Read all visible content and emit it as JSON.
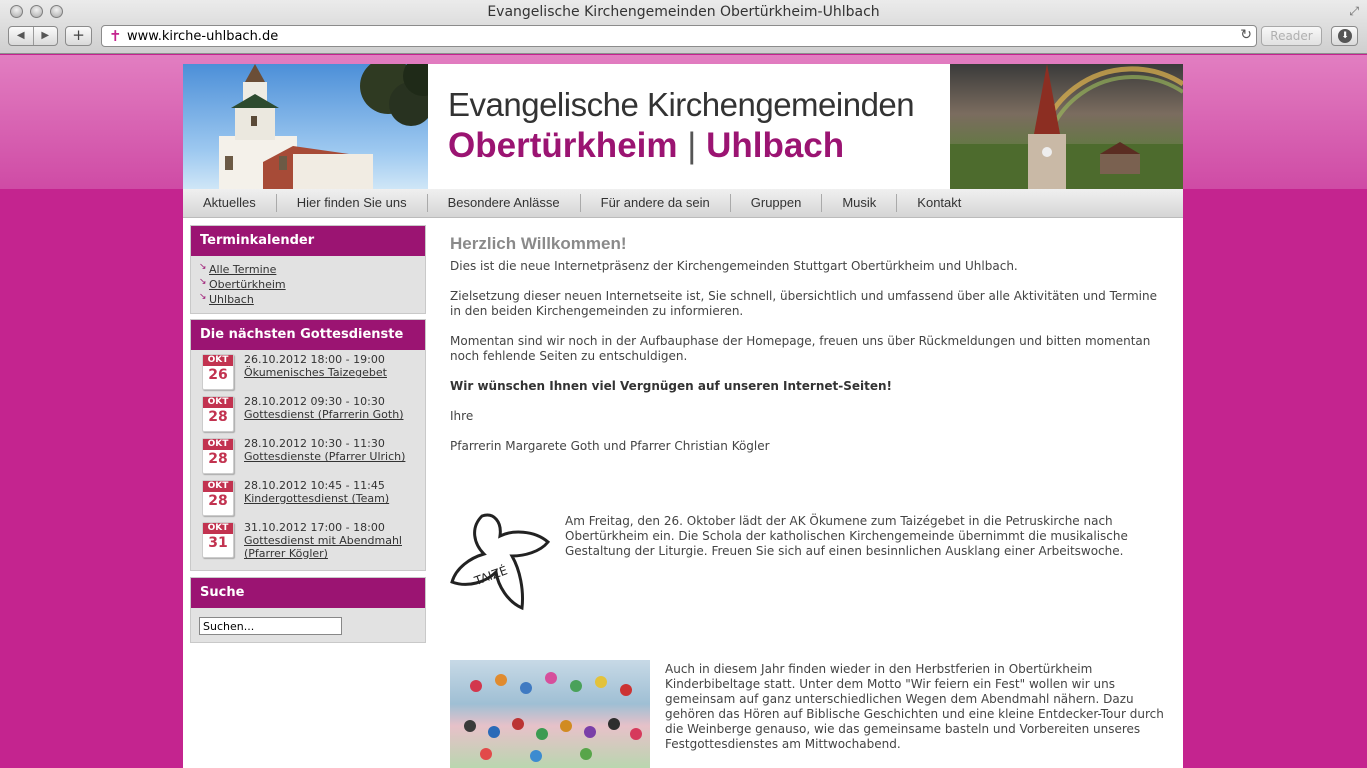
{
  "browser": {
    "window_title": "Evangelische Kirchengemeinden Obertürkheim-Uhlbach",
    "url": "www.kirche-uhlbach.de",
    "reader_label": "Reader"
  },
  "header": {
    "line1": "Evangelische Kirchengemeinden",
    "line2_left": "Obertürkheim",
    "line2_sep": "|",
    "line2_right": "Uhlbach"
  },
  "nav": [
    "Aktuelles",
    "Hier finden Sie uns",
    "Besondere Anlässe",
    "Für andere da sein",
    "Gruppen",
    "Musik",
    "Kontakt"
  ],
  "sidebar": {
    "termin_title": "Terminkalender",
    "termin_links": [
      "Alle Termine",
      "Obertürkheim",
      "Uhlbach"
    ],
    "gd_title": "Die nächsten Gottesdienste",
    "events": [
      {
        "month": "OKT",
        "day": "26",
        "datetime": "26.10.2012 18:00 - 19:00",
        "title": "Ökumenisches Taizegebet"
      },
      {
        "month": "OKT",
        "day": "28",
        "datetime": "28.10.2012 09:30 - 10:30",
        "title": "Gottesdienst (Pfarrerin Goth)"
      },
      {
        "month": "OKT",
        "day": "28",
        "datetime": "28.10.2012 10:30 - 11:30",
        "title": "Gottesdienste (Pfarrer Ulrich)"
      },
      {
        "month": "OKT",
        "day": "28",
        "datetime": "28.10.2012 10:45 - 11:45",
        "title": "Kindergottesdienst (Team)"
      },
      {
        "month": "OKT",
        "day": "31",
        "datetime": "31.10.2012 17:00 - 18:00",
        "title": "Gottesdienst mit Abendmahl (Pfarrer Kögler)"
      }
    ],
    "search_title": "Suche",
    "search_value": "Suchen..."
  },
  "content": {
    "title": "Herzlich Willkommen!",
    "p1": "Dies ist die neue Internetpräsenz der Kirchengemeinden Stuttgart Obertürkheim und Uhlbach.",
    "p2": "Zielsetzung dieser neuen Internetseite ist, Sie schnell, übersichtlich und umfassend über alle Aktivitäten und Termine in den beiden Kirchengemeinden zu informieren.",
    "p3": "Momentan sind wir noch in der Aufbauphase der Homepage, freuen uns über Rückmeldungen und bitten momentan noch fehlende Seiten zu entschuldigen.",
    "p4": "Wir wünschen Ihnen viel Vergnügen auf unseren Internet-Seiten!",
    "p5": "Ihre",
    "p6": "Pfarrerin Margarete Goth und Pfarrer Christian Kögler",
    "news1_logo": "TAIZÉ",
    "news1": "Am Freitag, den 26. Oktober lädt der AK Ökumene zum Taizégebet in die Petruskirche nach Obertürkheim ein. Die Schola der katholischen Kirchengemeinde übernimmt die musikalische Gestaltung der Liturgie. Freuen Sie sich auf einen besinnlichen Ausklang einer Arbeitswoche.",
    "news2": "Auch in diesem Jahr finden wieder in den Herbstferien in Obertürkheim Kinderbibeltage statt. Unter dem Motto \"Wir feiern ein Fest\" wollen wir uns gemeinsam auf ganz unterschiedlichen Wegen dem Abendmahl nähern. Dazu gehören das Hören auf Biblische Geschichten und eine kleine Entdecker-Tour durch die Weinberge genauso, wie das gemeinsame basteln und Vorbereiten unseres Festgottesdienstes am Mittwochabend."
  }
}
